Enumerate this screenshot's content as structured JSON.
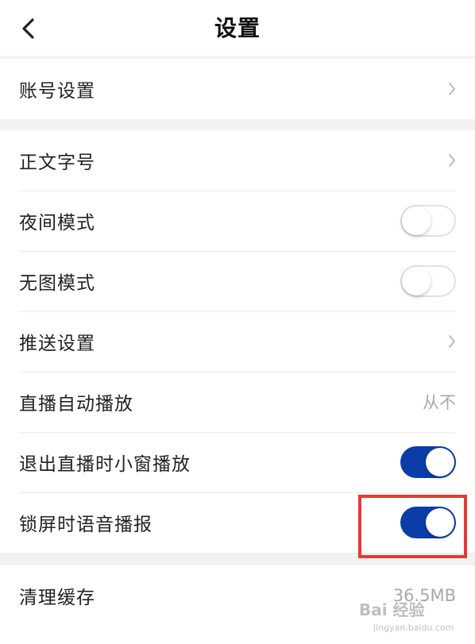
{
  "nav": {
    "title": "设置"
  },
  "groups": [
    {
      "items": [
        {
          "label": "账号设置",
          "type": "chevron"
        }
      ]
    },
    {
      "items": [
        {
          "label": "正文字号",
          "type": "chevron"
        },
        {
          "label": "夜间模式",
          "type": "toggle",
          "on": false
        },
        {
          "label": "无图模式",
          "type": "toggle",
          "on": false
        },
        {
          "label": "推送设置",
          "type": "chevron"
        },
        {
          "label": "直播自动播放",
          "type": "value",
          "value": "从不"
        },
        {
          "label": "退出直播时小窗播放",
          "type": "toggle",
          "on": true
        },
        {
          "label": "锁屏时语音播报",
          "type": "toggle",
          "on": true
        }
      ]
    },
    {
      "items": [
        {
          "label": "清理缓存",
          "type": "value",
          "value": "36.5MB"
        }
      ]
    }
  ],
  "colors": {
    "accent": "#0a3da8",
    "highlight": "#e53935"
  },
  "icons": {
    "back": "chevron-left-icon",
    "row": "chevron-right-icon"
  },
  "watermark": {
    "text": "Bai 经验",
    "sub": "jingyan.baidu.com"
  }
}
